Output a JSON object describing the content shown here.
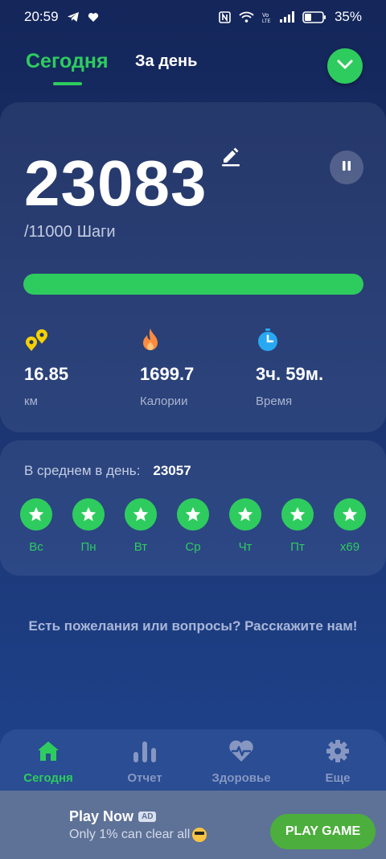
{
  "status_bar": {
    "time": "20:59",
    "battery": "35%",
    "icons_left": [
      "telegram-icon",
      "heart-icon"
    ],
    "icons_right": [
      "nfc-icon",
      "wifi-icon",
      "volte-icon",
      "signal-icon",
      "battery-icon"
    ]
  },
  "header": {
    "tab_today": "Сегодня",
    "tab_day": "За день"
  },
  "summary": {
    "steps": "23083",
    "goal": "/11000",
    "goal_unit": "Шаги",
    "progress_fraction": 1.0,
    "stats": [
      {
        "icon": "distance-icon",
        "value": "16.85",
        "label": "км",
        "color": "#f5d000"
      },
      {
        "icon": "flame-icon",
        "value": "1699.7",
        "label": "Калории",
        "color": "#ff8a3d"
      },
      {
        "icon": "stopwatch-icon",
        "value": "3ч. 59м.",
        "label": "Время",
        "color": "#29a8f2"
      }
    ]
  },
  "average": {
    "label": "В среднем в день:",
    "value": "23057",
    "days": [
      {
        "label": "Вс"
      },
      {
        "label": "Пн"
      },
      {
        "label": "Вт"
      },
      {
        "label": "Ср"
      },
      {
        "label": "Чт"
      },
      {
        "label": "Пт"
      },
      {
        "label": "x69"
      }
    ]
  },
  "feedback": "Есть пожелания или вопросы? Расскажите нам!",
  "bottom_nav": {
    "items": [
      {
        "icon": "home-icon",
        "label": "Сегодня",
        "active": true
      },
      {
        "icon": "bar-chart-icon",
        "label": "Отчет",
        "active": false
      },
      {
        "icon": "heart-pulse-icon",
        "label": "Здоровье",
        "active": false
      },
      {
        "icon": "gear-icon",
        "label": "Еще",
        "active": false
      }
    ]
  },
  "ad": {
    "title": "Play Now",
    "badge": "AD",
    "subtitle": "Only 1% can clear all",
    "button": "PLAY GAME"
  },
  "colors": {
    "accent": "#2ecc5e",
    "background_top": "#14265a",
    "background_bottom": "#1f4590"
  }
}
